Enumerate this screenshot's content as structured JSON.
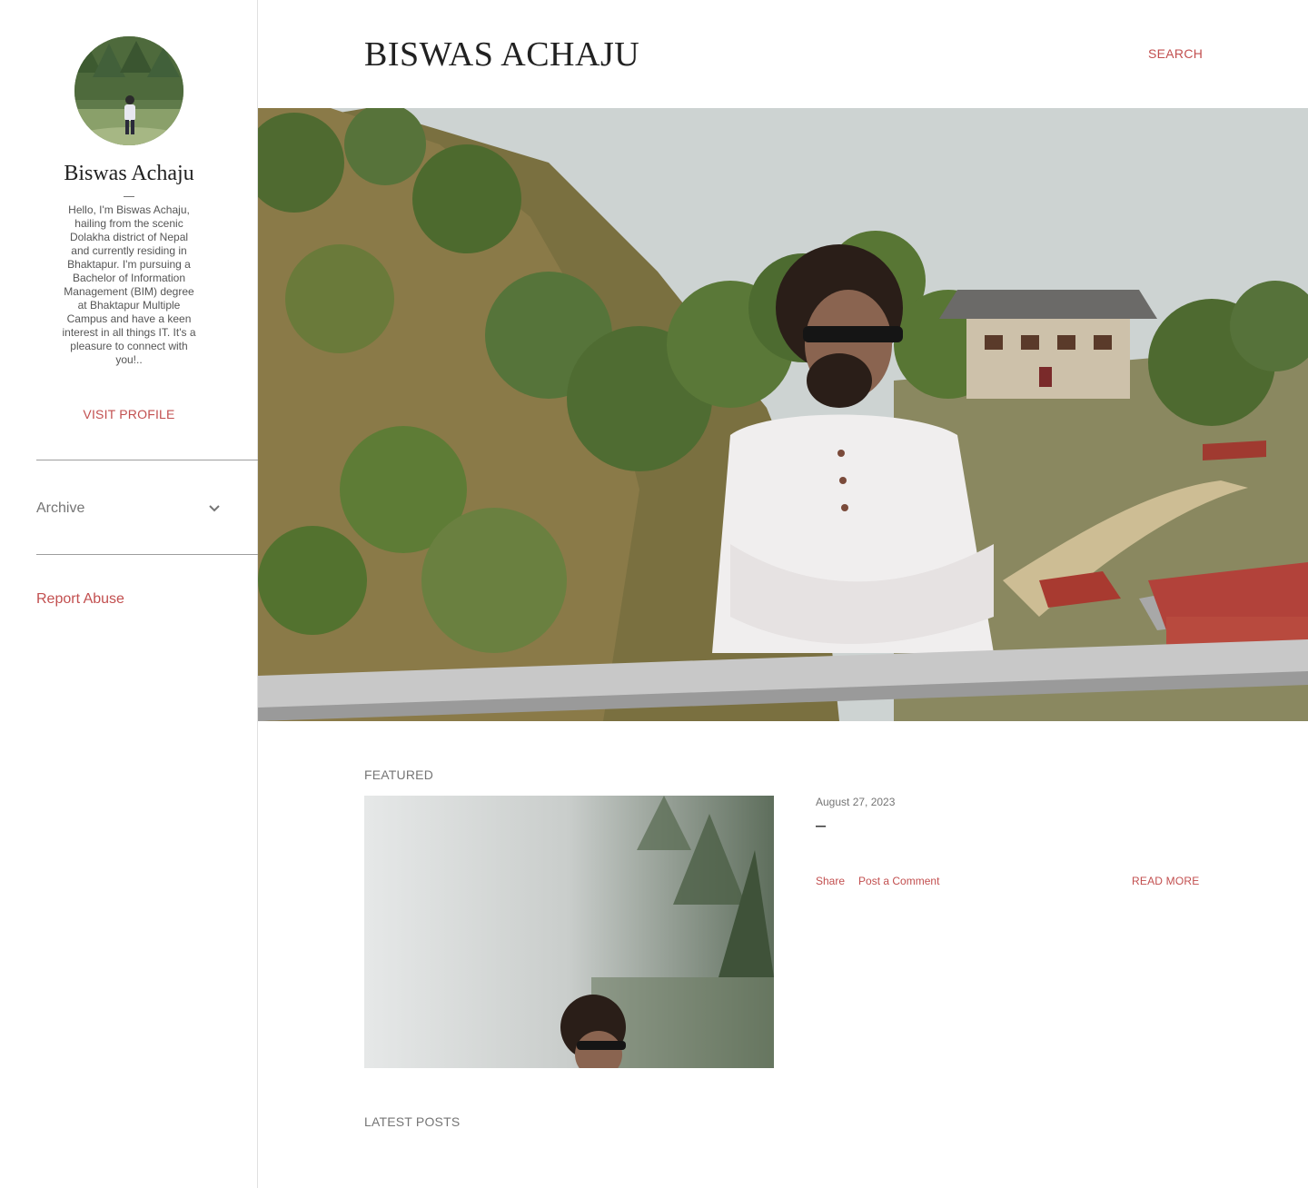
{
  "sidebar": {
    "profile_name": "Biswas Achaju",
    "profile_bio": "Hello, I'm Biswas Achaju, hailing from the scenic Dolakha district of Nepal and currently residing in Bhaktapur. I'm pursuing a Bachelor of Information Management (BIM) degree at Bhaktapur Multiple Campus and have a keen interest in all things IT. It's a pleasure to connect with you!..",
    "visit_profile": "VISIT PROFILE",
    "archive_label": "Archive",
    "report_abuse": "Report Abuse"
  },
  "header": {
    "title": "BISWAS ACHAJU",
    "search": "SEARCH"
  },
  "featured": {
    "label": "FEATURED",
    "date": "August 27, 2023",
    "title": "–",
    "share": "Share",
    "post_comment": "Post a Comment",
    "read_more": "READ MORE"
  },
  "latest": {
    "label": "LATEST POSTS"
  },
  "colors": {
    "accent": "#c24f4f",
    "text": "#212121",
    "muted": "#757575"
  }
}
